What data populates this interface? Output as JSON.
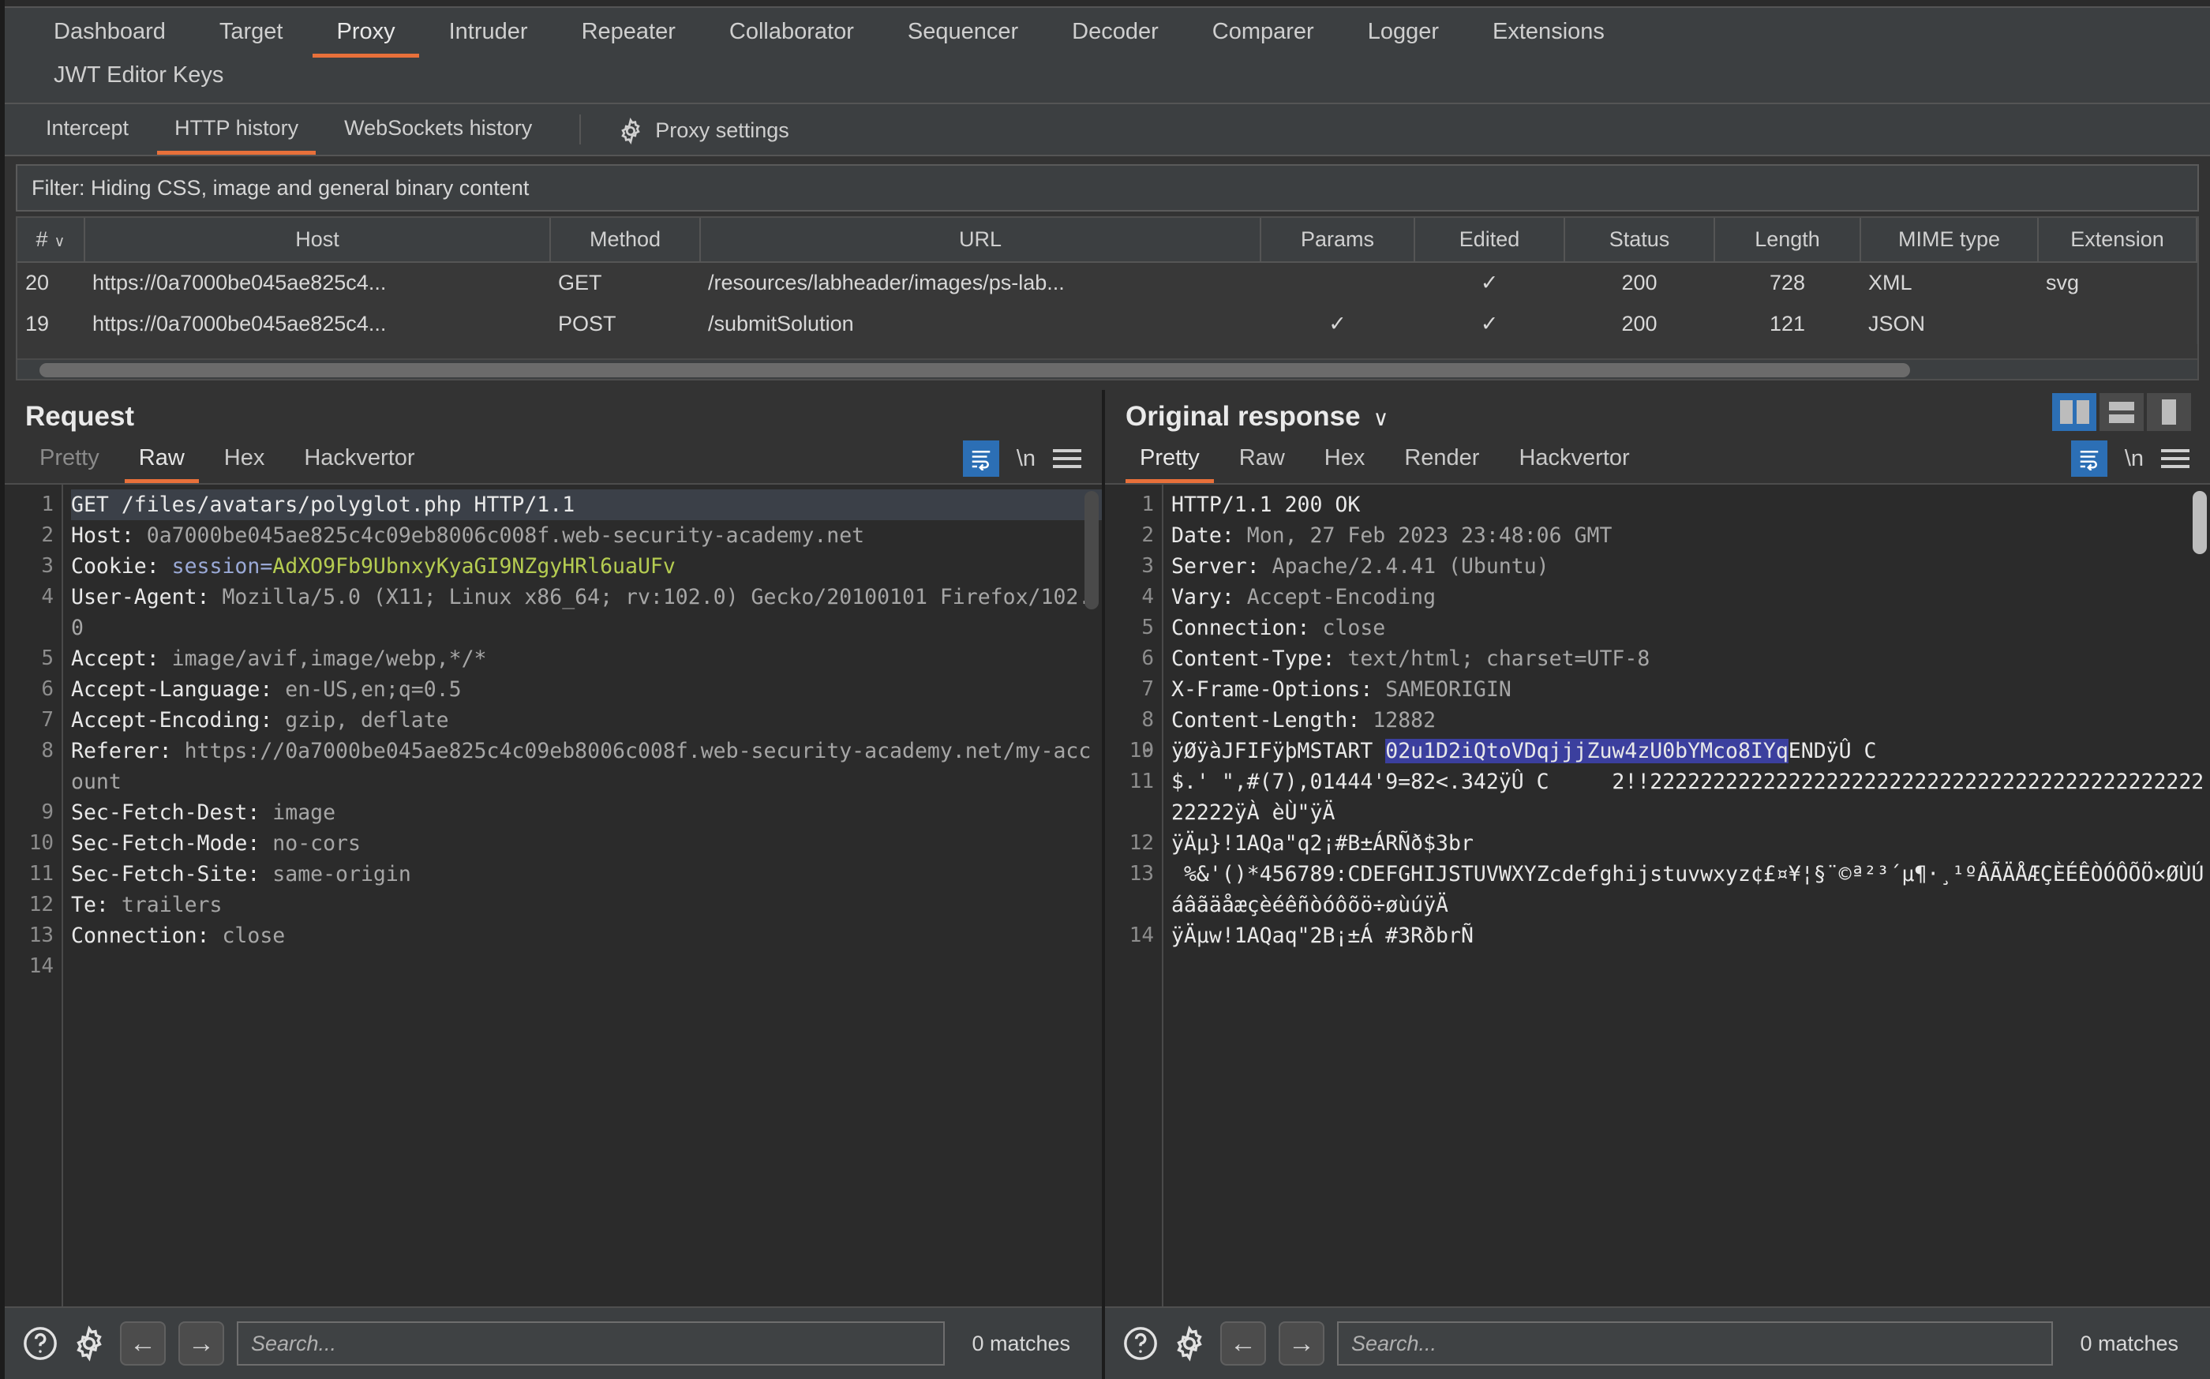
{
  "main_tabs": [
    {
      "label": "Dashboard",
      "active": false
    },
    {
      "label": "Target",
      "active": false
    },
    {
      "label": "Proxy",
      "active": true
    },
    {
      "label": "Intruder",
      "active": false
    },
    {
      "label": "Repeater",
      "active": false
    },
    {
      "label": "Collaborator",
      "active": false
    },
    {
      "label": "Sequencer",
      "active": false
    },
    {
      "label": "Decoder",
      "active": false
    },
    {
      "label": "Comparer",
      "active": false
    },
    {
      "label": "Logger",
      "active": false
    },
    {
      "label": "Extensions",
      "active": false
    }
  ],
  "main_tabs_row2": [
    {
      "label": "JWT Editor Keys",
      "active": false
    }
  ],
  "sub_tabs": [
    {
      "label": "Intercept",
      "active": false
    },
    {
      "label": "HTTP history",
      "active": true
    },
    {
      "label": "WebSockets history",
      "active": false
    }
  ],
  "proxy_settings_label": "Proxy settings",
  "filter": {
    "text": "Filter: Hiding CSS, image and general binary content"
  },
  "history_table": {
    "columns": [
      "#",
      "Host",
      "Method",
      "URL",
      "Params",
      "Edited",
      "Status",
      "Length",
      "MIME type",
      "Extension"
    ],
    "sort_caret": "∨",
    "rows": [
      {
        "num": "20",
        "host": "https://0a7000be045ae825c4...",
        "method": "GET",
        "url": "/resources/labheader/images/ps-lab...",
        "params": "",
        "edited": "✓",
        "status": "200",
        "length": "728",
        "mime": "XML",
        "extension": "svg"
      },
      {
        "num": "19",
        "host": "https://0a7000be045ae825c4...",
        "method": "POST",
        "url": "/submitSolution",
        "params": "✓",
        "edited": "✓",
        "status": "200",
        "length": "121",
        "mime": "JSON",
        "extension": ""
      }
    ]
  },
  "request_pane": {
    "title": "Request",
    "tabs": [
      {
        "label": "Pretty",
        "active": false,
        "dim": true
      },
      {
        "label": "Raw",
        "active": true,
        "dim": false
      },
      {
        "label": "Hex",
        "active": false,
        "dim": false
      },
      {
        "label": "Hackvertor",
        "active": false,
        "dim": false
      }
    ],
    "newline_label": "\\n",
    "lines": [
      {
        "n": "1",
        "segments": [
          {
            "t": "GET /files/avatars/polyglot.php HTTP/1.1",
            "c": "tok-hdr"
          }
        ],
        "selected": true
      },
      {
        "n": "2",
        "segments": [
          {
            "t": "Host: ",
            "c": "tok-hdr"
          },
          {
            "t": "0a7000be045ae825c4c09eb8006c008f.web-security-academy.net",
            "c": "tok-val"
          }
        ]
      },
      {
        "n": "3",
        "segments": [
          {
            "t": "Cookie: ",
            "c": "tok-hdr"
          },
          {
            "t": "session=",
            "c": "tok-cook"
          },
          {
            "t": "AdXO9Fb9UbnxyKyaGI9NZgyHRl6uaUFv",
            "c": "tok-cookval"
          }
        ]
      },
      {
        "n": "4",
        "segments": [
          {
            "t": "User-Agent: ",
            "c": "tok-hdr"
          },
          {
            "t": "Mozilla/5.0 (X11; Linux x86_64; rv:102.0) Gecko/20100101 Firefox/102.0",
            "c": "tok-val"
          }
        ]
      },
      {
        "n": "5",
        "segments": [
          {
            "t": "Accept: ",
            "c": "tok-hdr"
          },
          {
            "t": "image/avif,image/webp,*/*",
            "c": "tok-val"
          }
        ]
      },
      {
        "n": "6",
        "segments": [
          {
            "t": "Accept-Language: ",
            "c": "tok-hdr"
          },
          {
            "t": "en-US,en;q=0.5",
            "c": "tok-val"
          }
        ]
      },
      {
        "n": "7",
        "segments": [
          {
            "t": "Accept-Encoding: ",
            "c": "tok-hdr"
          },
          {
            "t": "gzip, deflate",
            "c": "tok-val"
          }
        ]
      },
      {
        "n": "8",
        "segments": [
          {
            "t": "Referer: ",
            "c": "tok-hdr"
          },
          {
            "t": "https://0a7000be045ae825c4c09eb8006c008f.web-security-academy.net/my-account",
            "c": "tok-val"
          }
        ]
      },
      {
        "n": "9",
        "segments": [
          {
            "t": "Sec-Fetch-Dest: ",
            "c": "tok-hdr"
          },
          {
            "t": "image",
            "c": "tok-val"
          }
        ]
      },
      {
        "n": "10",
        "segments": [
          {
            "t": "Sec-Fetch-Mode: ",
            "c": "tok-hdr"
          },
          {
            "t": "no-cors",
            "c": "tok-val"
          }
        ]
      },
      {
        "n": "11",
        "segments": [
          {
            "t": "Sec-Fetch-Site: ",
            "c": "tok-hdr"
          },
          {
            "t": "same-origin",
            "c": "tok-val"
          }
        ]
      },
      {
        "n": "12",
        "segments": [
          {
            "t": "Te: ",
            "c": "tok-hdr"
          },
          {
            "t": "trailers",
            "c": "tok-val"
          }
        ]
      },
      {
        "n": "13",
        "segments": [
          {
            "t": "Connection: ",
            "c": "tok-hdr"
          },
          {
            "t": "close",
            "c": "tok-val"
          }
        ]
      },
      {
        "n": "14",
        "segments": [
          {
            "t": "",
            "c": "tok-val"
          }
        ]
      }
    ],
    "search_placeholder": "Search...",
    "matches": "0 matches"
  },
  "response_pane": {
    "title": "Original response",
    "title_chevron": "∨",
    "tabs": [
      {
        "label": "Pretty",
        "active": true,
        "dim": false
      },
      {
        "label": "Raw",
        "active": false,
        "dim": false
      },
      {
        "label": "Hex",
        "active": false,
        "dim": false
      },
      {
        "label": "Render",
        "active": false,
        "dim": false
      },
      {
        "label": "Hackvertor",
        "active": false,
        "dim": false
      }
    ],
    "newline_label": "\\n",
    "view_modes": [
      {
        "name": "split-vertical",
        "active": true
      },
      {
        "name": "split-horizontal",
        "active": false
      },
      {
        "name": "single-pane",
        "active": false
      }
    ],
    "lines": [
      {
        "n": "1",
        "segments": [
          {
            "t": "HTTP/1.1 200 OK",
            "c": "tok-hdr"
          }
        ]
      },
      {
        "n": "2",
        "segments": [
          {
            "t": "Date: ",
            "c": "tok-hdr"
          },
          {
            "t": "Mon, 27 Feb 2023 23:48:06 GMT",
            "c": "tok-val"
          }
        ]
      },
      {
        "n": "3",
        "segments": [
          {
            "t": "Server: ",
            "c": "tok-hdr"
          },
          {
            "t": "Apache/2.4.41 (Ubuntu)",
            "c": "tok-val"
          }
        ]
      },
      {
        "n": "4",
        "segments": [
          {
            "t": "Vary: ",
            "c": "tok-hdr"
          },
          {
            "t": "Accept-Encoding",
            "c": "tok-val"
          }
        ]
      },
      {
        "n": "5",
        "segments": [
          {
            "t": "Connection: ",
            "c": "tok-hdr"
          },
          {
            "t": "close",
            "c": "tok-val"
          }
        ]
      },
      {
        "n": "6",
        "segments": [
          {
            "t": "Content-Type: ",
            "c": "tok-hdr"
          },
          {
            "t": "text/html; charset=UTF-8",
            "c": "tok-val"
          }
        ]
      },
      {
        "n": "7",
        "segments": [
          {
            "t": "X-Frame-Options: ",
            "c": "tok-hdr"
          },
          {
            "t": "SAMEORIGIN",
            "c": "tok-val"
          }
        ]
      },
      {
        "n": "8",
        "segments": [
          {
            "t": "Content-Length: ",
            "c": "tok-hdr"
          },
          {
            "t": "12882",
            "c": "tok-val"
          }
        ]
      },
      {
        "n": "9",
        "segments": [
          {
            "t": "",
            "c": "tok-val"
          }
        ]
      },
      {
        "n": "10",
        "segments": [
          {
            "t": "ÿØÿàJFIFÿþMSTART ",
            "c": "tok-hdr"
          },
          {
            "t": "02u1D2iQtoVDqjjjZuw4zU0bYMco8IYq",
            "c": "hl"
          },
          {
            "t": "ENDÿÛ C",
            "c": "tok-hdr"
          }
        ]
      },
      {
        "n": "11",
        "segments": [
          {
            "t": "$.' \",#(7),01444'9=82<.342ÿÛ C     2!!2222222222222222222222222222222222222222222222222ÿÀ èÙ\"ÿÄ",
            "c": "tok-hdr"
          }
        ]
      },
      {
        "n": "12",
        "segments": [
          {
            "t": "ÿÄµ}!1AQa\"q2¡#B±ÁRÑð$3br",
            "c": "tok-hdr"
          }
        ]
      },
      {
        "n": "13",
        "segments": [
          {
            "t": " %&'()*456789:CDEFGHIJSTUVWXYZcdefghijstuvwxyz¢£¤¥¦§¨©ª²³´µ¶·¸¹ºÂÃÄÅÆÇÈÉÊÒÓÔÕÖ×ØÙÚáâãäåæçèéêñòóôõö÷øùúÿÄ",
            "c": "tok-hdr"
          }
        ]
      },
      {
        "n": "14",
        "segments": [
          {
            "t": "ÿÄµw!1AQaq\"2B¡±Á #3RðbrÑ",
            "c": "tok-hdr"
          }
        ]
      }
    ],
    "search_placeholder": "Search...",
    "matches": "0 matches"
  },
  "colors": {
    "accent": "#e8703a",
    "selection": "#3b3f9e",
    "blue_button": "#2c6fb5",
    "cookie_value": "#b5cc51",
    "background": "#333333"
  }
}
